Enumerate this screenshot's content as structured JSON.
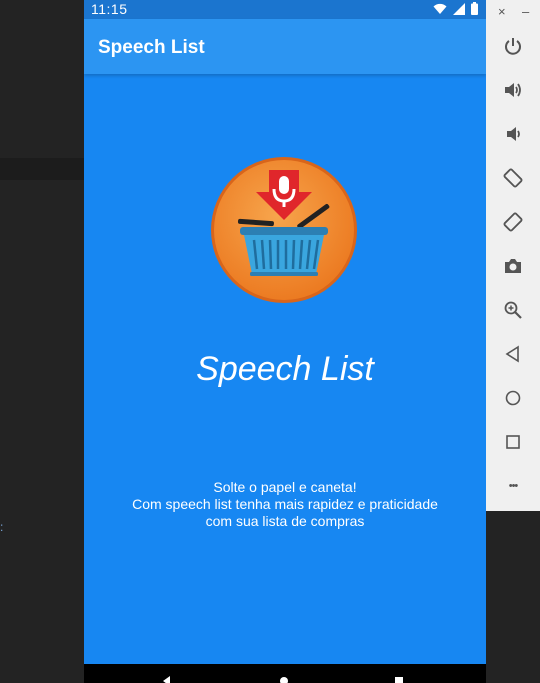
{
  "status_bar": {
    "time": "11:15"
  },
  "app_bar": {
    "title": "Speech List"
  },
  "splash": {
    "title": "Speech List",
    "tagline_lines": [
      "Solte o papel e caneta!",
      "Com speech list tenha mais rapidez e praticidade",
      "com sua lista de compras"
    ]
  },
  "emulator_toolbar": {
    "close": "×",
    "minimize": "–",
    "more": "•••",
    "tools": [
      "power-icon",
      "volume-up-icon",
      "volume-down-icon",
      "rotate-left-icon",
      "rotate-right-icon",
      "camera-icon",
      "zoom-icon",
      "back-icon",
      "home-icon",
      "overview-icon",
      "more-icon"
    ]
  },
  "colors": {
    "background": "#1787f2",
    "app_bar": "#2c95f2",
    "status_bar": "#1b75cf",
    "logo_orange": "#f28a2e",
    "logo_red": "#e0262b",
    "basket_blue": "#3aa6df"
  }
}
